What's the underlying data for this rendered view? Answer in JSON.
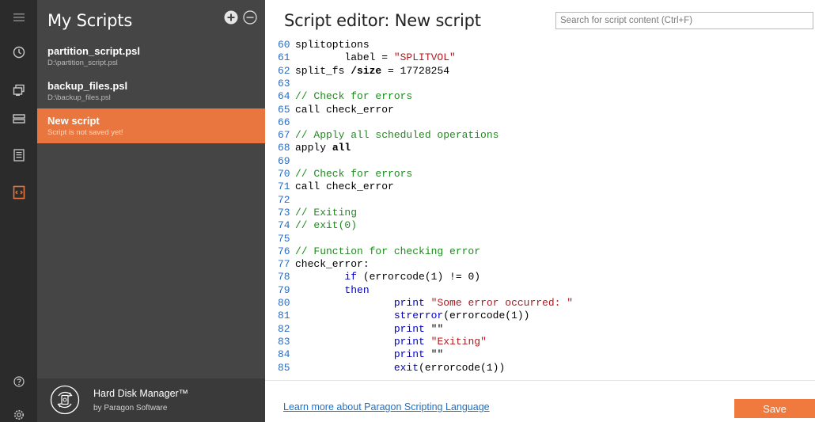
{
  "panel": {
    "title": "My Scripts",
    "scripts": [
      {
        "name": "partition_script.psl",
        "path": "D:\\partition_script.psl"
      },
      {
        "name": "backup_files.psl",
        "path": "D:\\backup_files.psl"
      },
      {
        "name": "New script",
        "path": "Script is not saved yet!"
      }
    ],
    "active_index": 2
  },
  "brand": {
    "name": "Hard Disk Manager™",
    "by": "by Paragon Software"
  },
  "editor": {
    "title": "Script editor: New script",
    "search_placeholder": "Search for script content (Ctrl+F)",
    "lines": [
      {
        "n": "60",
        "tokens": [
          {
            "t": "splitoptions",
            "c": "plain"
          }
        ]
      },
      {
        "n": "61",
        "tokens": [
          {
            "t": "        label = ",
            "c": "plain"
          },
          {
            "t": "\"SPLITVOL\"",
            "c": "str"
          }
        ]
      },
      {
        "n": "62",
        "tokens": [
          {
            "t": "split_fs ",
            "c": "plain"
          },
          {
            "t": "/size",
            "c": "bold"
          },
          {
            "t": " = 17728254",
            "c": "plain"
          }
        ]
      },
      {
        "n": "63",
        "tokens": []
      },
      {
        "n": "64",
        "tokens": [
          {
            "t": "// Check for errors",
            "c": "cmt"
          }
        ]
      },
      {
        "n": "65",
        "tokens": [
          {
            "t": "call check_error",
            "c": "plain"
          }
        ]
      },
      {
        "n": "66",
        "tokens": []
      },
      {
        "n": "67",
        "tokens": [
          {
            "t": "// Apply all scheduled operations",
            "c": "cmt"
          }
        ]
      },
      {
        "n": "68",
        "tokens": [
          {
            "t": "apply ",
            "c": "plain"
          },
          {
            "t": "all",
            "c": "bold"
          }
        ]
      },
      {
        "n": "69",
        "tokens": []
      },
      {
        "n": "70",
        "tokens": [
          {
            "t": "// Check for errors",
            "c": "cmt"
          }
        ]
      },
      {
        "n": "71",
        "tokens": [
          {
            "t": "call check_error",
            "c": "plain"
          }
        ]
      },
      {
        "n": "72",
        "tokens": []
      },
      {
        "n": "73",
        "tokens": [
          {
            "t": "// Exiting",
            "c": "cmt"
          }
        ]
      },
      {
        "n": "74",
        "tokens": [
          {
            "t": "// exit(0)",
            "c": "cmt"
          }
        ]
      },
      {
        "n": "75",
        "tokens": []
      },
      {
        "n": "76",
        "tokens": [
          {
            "t": "// Function for checking error",
            "c": "cmt"
          }
        ]
      },
      {
        "n": "77",
        "tokens": [
          {
            "t": "check_error:",
            "c": "plain"
          }
        ]
      },
      {
        "n": "78",
        "tokens": [
          {
            "t": "        ",
            "c": "plain"
          },
          {
            "t": "if",
            "c": "kw"
          },
          {
            "t": " (errorcode(1) != 0)",
            "c": "plain"
          }
        ]
      },
      {
        "n": "79",
        "tokens": [
          {
            "t": "        ",
            "c": "plain"
          },
          {
            "t": "then",
            "c": "kw"
          }
        ]
      },
      {
        "n": "80",
        "tokens": [
          {
            "t": "                ",
            "c": "plain"
          },
          {
            "t": "print",
            "c": "kw"
          },
          {
            "t": " ",
            "c": "plain"
          },
          {
            "t": "\"Some error occurred: \"",
            "c": "str"
          }
        ]
      },
      {
        "n": "81",
        "tokens": [
          {
            "t": "                ",
            "c": "plain"
          },
          {
            "t": "strerror",
            "c": "kw"
          },
          {
            "t": "(errorcode(1))",
            "c": "plain"
          }
        ]
      },
      {
        "n": "82",
        "tokens": [
          {
            "t": "                ",
            "c": "plain"
          },
          {
            "t": "print",
            "c": "kw"
          },
          {
            "t": " \"\"",
            "c": "plain"
          }
        ]
      },
      {
        "n": "83",
        "tokens": [
          {
            "t": "                ",
            "c": "plain"
          },
          {
            "t": "print",
            "c": "kw"
          },
          {
            "t": " ",
            "c": "plain"
          },
          {
            "t": "\"Exiting\"",
            "c": "str"
          }
        ]
      },
      {
        "n": "84",
        "tokens": [
          {
            "t": "                ",
            "c": "plain"
          },
          {
            "t": "print",
            "c": "kw"
          },
          {
            "t": " \"\"",
            "c": "plain"
          }
        ]
      },
      {
        "n": "85",
        "tokens": [
          {
            "t": "                ",
            "c": "plain"
          },
          {
            "t": "exit",
            "c": "kw"
          },
          {
            "t": "(errorcode(1))",
            "c": "plain"
          }
        ]
      }
    ]
  },
  "footer": {
    "link": "Learn more about Paragon Scripting Language",
    "save": "Save"
  },
  "rail": {
    "icons": [
      "menu-icon",
      "history-icon",
      "copy-icon",
      "disk-icon",
      "list-icon",
      "script-icon",
      "help-icon",
      "settings-icon"
    ],
    "active": "script-icon",
    "accent": "#e8763e"
  }
}
